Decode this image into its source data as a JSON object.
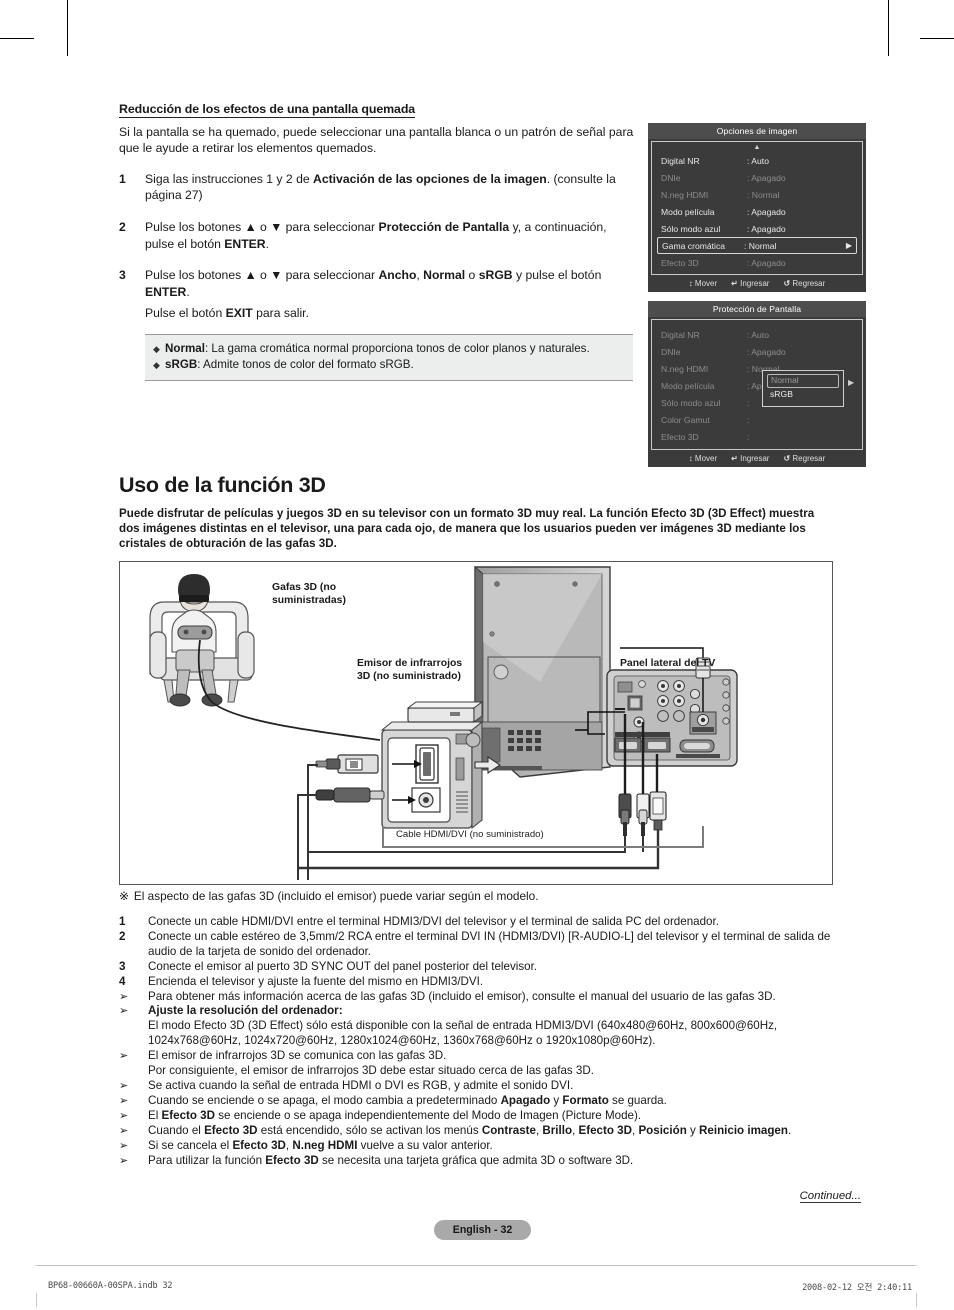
{
  "section": {
    "heading": "Reducción de los efectos de una pantalla quemada",
    "intro": "Si la pantalla se ha quemado, puede seleccionar una pantalla blanca o un patrón de señal para que le ayude a retirar los elementos quemados.",
    "steps": [
      {
        "num": "1",
        "parts": [
          {
            "t": "Siga las instrucciones 1 y 2 de ",
            "b": false
          },
          {
            "t": "Activación de las opciones de la imagen",
            "b": true
          },
          {
            "t": ". (consulte la página 27)",
            "b": false
          }
        ]
      },
      {
        "num": "2",
        "parts": [
          {
            "t": "Pulse los botones ▲ o ▼ para seleccionar ",
            "b": false
          },
          {
            "t": "Protección de Pantalla",
            "b": true
          },
          {
            "t": " y, a continuación, pulse el botón ",
            "b": false
          },
          {
            "t": "ENTER",
            "b": true
          },
          {
            "t": ".",
            "b": false
          }
        ]
      },
      {
        "num": "3",
        "parts": [
          {
            "t": "Pulse los botones ▲ o ▼ para seleccionar ",
            "b": false
          },
          {
            "t": "Ancho",
            "b": true
          },
          {
            "t": ", ",
            "b": false
          },
          {
            "t": "Normal",
            "b": true
          },
          {
            "t": " o ",
            "b": false
          },
          {
            "t": "sRGB",
            "b": true
          },
          {
            "t": " y pulse el botón ",
            "b": false
          },
          {
            "t": "ENTER",
            "b": true
          },
          {
            "t": ".",
            "b": false
          }
        ],
        "sub": [
          {
            "t": "Pulse el botón ",
            "b": false
          },
          {
            "t": "EXIT",
            "b": true
          },
          {
            "t": " para salir.",
            "b": false
          }
        ]
      }
    ],
    "notebox": [
      [
        {
          "t": "Normal",
          "b": true
        },
        {
          "t": ": La gama cromática normal proporciona tonos de color planos y naturales.",
          "b": false
        }
      ],
      [
        {
          "t": "sRGB",
          "b": true
        },
        {
          "t": ": Admite tonos de color del formato sRGB.",
          "b": false
        }
      ]
    ],
    "bullet_glyph": "◆"
  },
  "osd_picture_options": {
    "title": "Opciones de imagen",
    "up_arrow": "▲",
    "rows": [
      {
        "label": "Digital NR",
        "value": ": Auto",
        "dim": false,
        "selected": false
      },
      {
        "label": "DNIe",
        "value": ": Apagado",
        "dim": true,
        "selected": false
      },
      {
        "label": "N.neg HDMI",
        "value": ": Normal",
        "dim": true,
        "selected": false
      },
      {
        "label": "Modo película",
        "value": ": Apagado",
        "dim": false,
        "selected": false
      },
      {
        "label": "Sólo modo azul",
        "value": ": Apagado",
        "dim": false,
        "selected": false
      },
      {
        "label": "Gama cromática",
        "value": ": Normal",
        "dim": false,
        "selected": true,
        "arrow": "▶"
      },
      {
        "label": "Efecto 3D",
        "value": ": Apagado",
        "dim": true,
        "selected": false
      }
    ],
    "footer": [
      {
        "icon": "↕",
        "label": "Mover"
      },
      {
        "icon": "↵",
        "label": "Ingresar"
      },
      {
        "icon": "↺",
        "label": "Regresar"
      }
    ]
  },
  "osd_screen_protection": {
    "title": "Protección de Pantalla",
    "rows": [
      {
        "label": "Digital NR",
        "value": ": Auto",
        "dim": true
      },
      {
        "label": "DNIe",
        "value": ": Apagado",
        "dim": true
      },
      {
        "label": "N.neg HDMI",
        "value": ": Normal",
        "dim": true
      },
      {
        "label": "Modo película",
        "value": ": Apagado",
        "dim": true
      },
      {
        "label": "Sólo modo azul",
        "value": ":",
        "dim": true
      },
      {
        "label": "Color Gamut",
        "value": ":",
        "dim": true
      },
      {
        "label": "Efecto 3D",
        "value": ":",
        "dim": true
      }
    ],
    "dropdown": {
      "options": [
        "Normal",
        "sRGB"
      ],
      "current": "Normal",
      "arrow": "▶"
    },
    "footer": [
      {
        "icon": "↕",
        "label": "Mover"
      },
      {
        "icon": "↵",
        "label": "Ingresar"
      },
      {
        "icon": "↺",
        "label": "Regresar"
      }
    ]
  },
  "feature": {
    "title": "Uso de la función 3D",
    "lead": "Puede disfrutar de películas y juegos 3D en su televisor con un formato 3D muy real. La función Efecto 3D (3D Effect) muestra dos imágenes distintas en el televisor, una para cada ojo, de manera que los usuarios pueden ver imágenes 3D mediante los cristales de obturación de las gafas 3D."
  },
  "figure": {
    "labels": {
      "glasses": "Gafas 3D (no suministradas)",
      "emitter": "Emisor de infrarrojos 3D (no suministrado)",
      "side_panel": "Panel lateral del TV",
      "cable": "Cable HDMI/DVI (no suministrado)"
    }
  },
  "figure_note": {
    "mark": "※",
    "text": "El aspecto de las gafas 3D (incluido el emisor) puede variar según el modelo."
  },
  "instructions": [
    {
      "mark": "1",
      "arrow": false,
      "parts": [
        {
          "t": "Conecte un cable HDMI/DVI entre el terminal HDMI3/DVI del televisor y el terminal de salida PC del ordenador.",
          "b": false
        }
      ]
    },
    {
      "mark": "2",
      "arrow": false,
      "parts": [
        {
          "t": "Conecte un cable estéreo de 3,5mm/2 RCA entre el terminal DVI IN (HDMI3/DVI) [R-AUDIO-L] del televisor y el terminal de salida de audio de la tarjeta de sonido del ordenador.",
          "b": false
        }
      ]
    },
    {
      "mark": "3",
      "arrow": false,
      "parts": [
        {
          "t": "Conecte el emisor al puerto 3D SYNC OUT del panel posterior del televisor.",
          "b": false
        }
      ]
    },
    {
      "mark": "4",
      "arrow": false,
      "parts": [
        {
          "t": "Encienda el televisor y ajuste la fuente del mismo en HDMI3/DVI.",
          "b": false
        }
      ]
    },
    {
      "mark": "➢",
      "arrow": true,
      "parts": [
        {
          "t": "Para obtener más información acerca de las gafas 3D (incluido el emisor), consulte el manual del usuario de las gafas 3D.",
          "b": false
        }
      ]
    },
    {
      "mark": "➢",
      "arrow": true,
      "parts": [
        {
          "t": "Ajuste la resolución del ordenador:",
          "b": true
        },
        {
          "t": "\nEl modo Efecto 3D (3D Effect) sólo está disponible con la señal de entrada HDMI3/DVI (640x480@60Hz, 800x600@60Hz, 1024x768@60Hz, 1024x720@60Hz, 1280x1024@60Hz, 1360x768@60Hz o 1920x1080p@60Hz).",
          "b": false
        }
      ]
    },
    {
      "mark": "➢",
      "arrow": true,
      "parts": [
        {
          "t": "El emisor de infrarrojos 3D se comunica con las gafas 3D.\nPor consiguiente, el emisor de infrarrojos 3D debe estar situado cerca de las gafas 3D.",
          "b": false
        }
      ]
    },
    {
      "mark": "➢",
      "arrow": true,
      "parts": [
        {
          "t": "Se activa cuando la señal de entrada HDMI o DVI es RGB, y admite el sonido DVI.",
          "b": false
        }
      ]
    },
    {
      "mark": "➢",
      "arrow": true,
      "parts": [
        {
          "t": "Cuando se enciende o se apaga, el modo cambia a predeterminado ",
          "b": false
        },
        {
          "t": "Apagado",
          "b": true
        },
        {
          "t": " y ",
          "b": false
        },
        {
          "t": "Formato",
          "b": true
        },
        {
          "t": " se guarda.",
          "b": false
        }
      ]
    },
    {
      "mark": "➢",
      "arrow": true,
      "parts": [
        {
          "t": "El ",
          "b": false
        },
        {
          "t": "Efecto 3D",
          "b": true
        },
        {
          "t": " se enciende o se apaga independientemente del Modo de Imagen (Picture Mode).",
          "b": false
        }
      ]
    },
    {
      "mark": "➢",
      "arrow": true,
      "parts": [
        {
          "t": "Cuando el ",
          "b": false
        },
        {
          "t": "Efecto 3D",
          "b": true
        },
        {
          "t": " está encendido, sólo se activan los menús ",
          "b": false
        },
        {
          "t": "Contraste",
          "b": true
        },
        {
          "t": ", ",
          "b": false
        },
        {
          "t": "Brillo",
          "b": true
        },
        {
          "t": ", ",
          "b": false
        },
        {
          "t": "Efecto 3D",
          "b": true
        },
        {
          "t": ", ",
          "b": false
        },
        {
          "t": "Posición",
          "b": true
        },
        {
          "t": " y ",
          "b": false
        },
        {
          "t": "Reinicio imagen",
          "b": true
        },
        {
          "t": ".",
          "b": false
        }
      ]
    },
    {
      "mark": "➢",
      "arrow": true,
      "parts": [
        {
          "t": "Si se cancela el ",
          "b": false
        },
        {
          "t": "Efecto 3D",
          "b": true
        },
        {
          "t": ", ",
          "b": false
        },
        {
          "t": "N.neg HDMI",
          "b": true
        },
        {
          "t": " vuelve a su valor anterior.",
          "b": false
        }
      ]
    },
    {
      "mark": "➢",
      "arrow": true,
      "parts": [
        {
          "t": "Para utilizar la función ",
          "b": false
        },
        {
          "t": "Efecto 3D",
          "b": true
        },
        {
          "t": " se necesita una tarjeta gráfica que admita 3D o software 3D.",
          "b": false
        }
      ]
    }
  ],
  "continued": "Continued...",
  "page_badge": "English - 32",
  "footer": {
    "left": "BP68-00660A-00SPA.indb   32",
    "right": "2008-02-12   오전 2:40:11"
  },
  "colors": {
    "osd_title_bg": "#4d4d4d",
    "osd_body_bg": "#3b3b3b",
    "osd_text": "#e8e8e8",
    "osd_dim_text": "#8c8c8c",
    "notebox_bg": "#eceded",
    "badge_bg": "#a9a9a9"
  }
}
